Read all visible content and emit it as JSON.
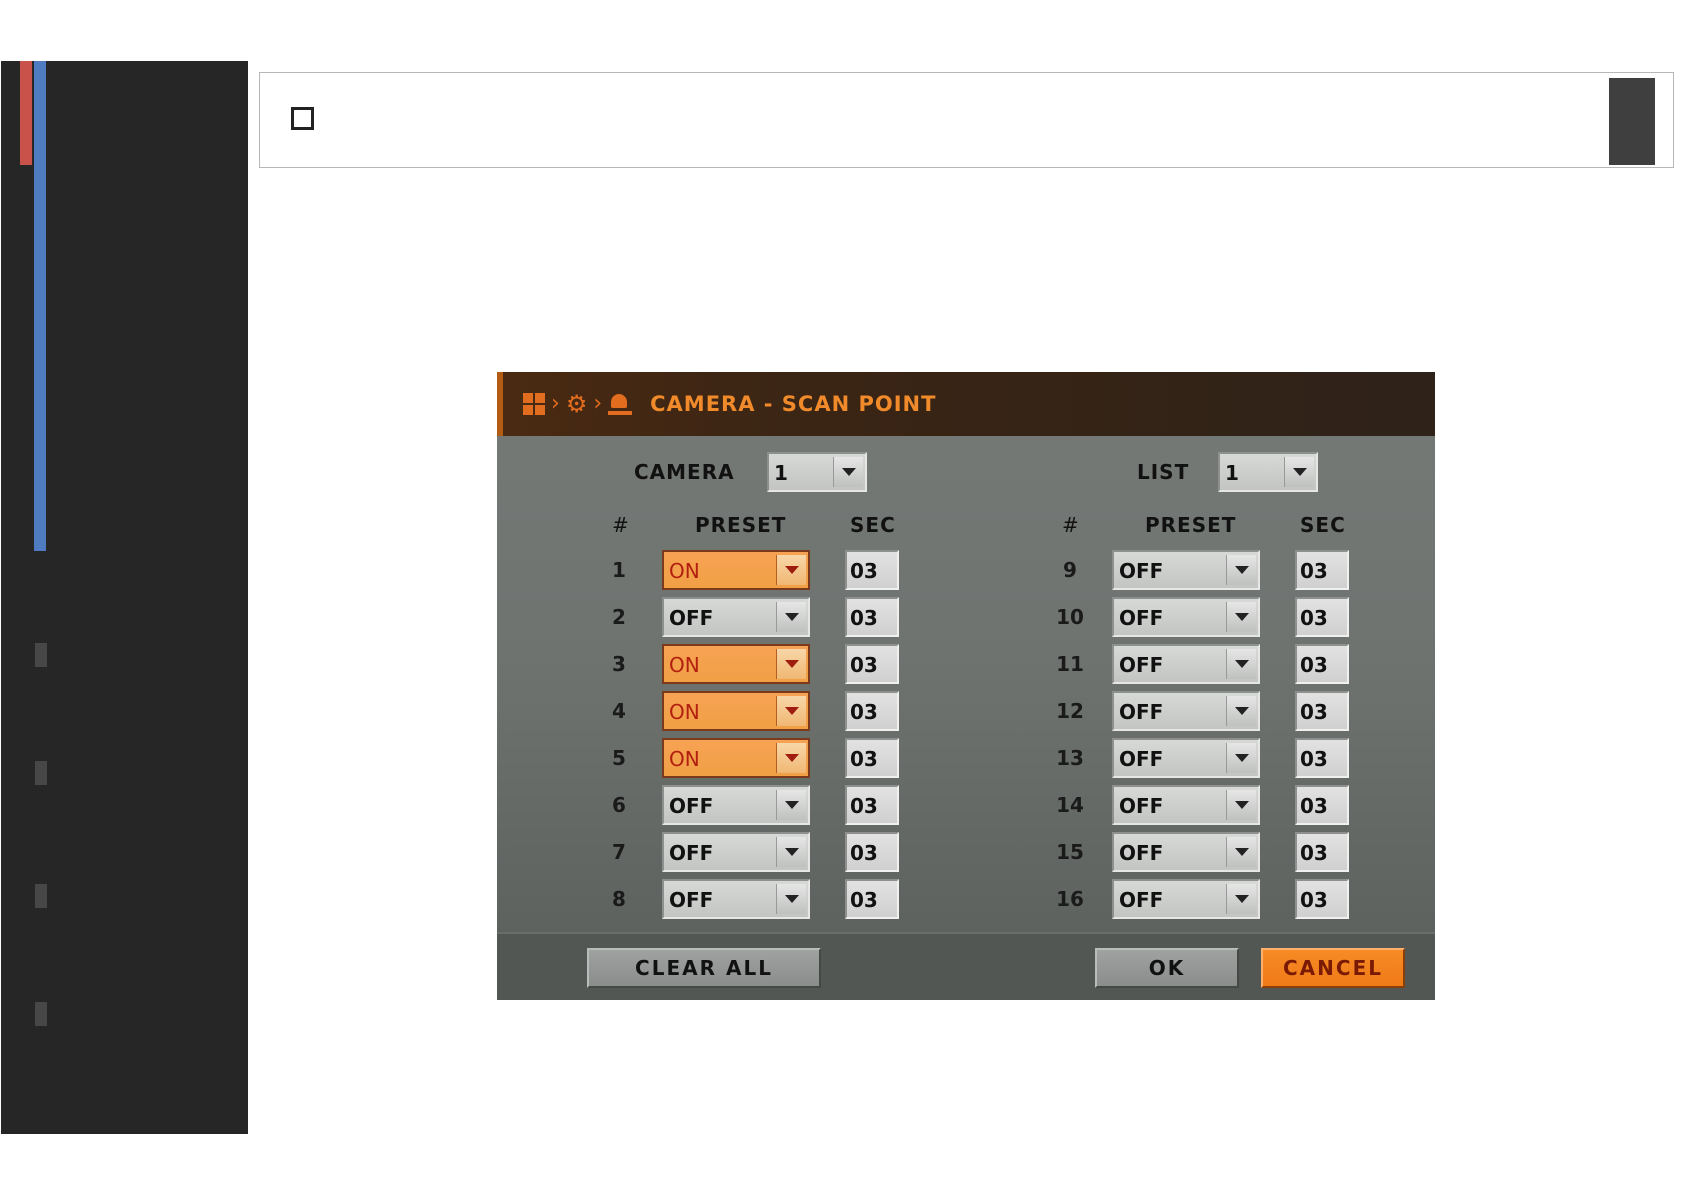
{
  "dialog": {
    "title": "CAMERA - SCAN POINT",
    "breadcrumb_icons": [
      "grid-icon",
      "chevron-right-icon",
      "gear-icon",
      "chevron-right-icon",
      "camera-icon"
    ],
    "camera_label": "CAMERA",
    "camera_value": "1",
    "list_label": "LIST",
    "list_value": "1",
    "headers": {
      "num": "#",
      "preset": "PRESET",
      "sec": "SEC"
    },
    "left_rows": [
      {
        "num": "1",
        "preset": "ON",
        "sec": "03"
      },
      {
        "num": "2",
        "preset": "OFF",
        "sec": "03"
      },
      {
        "num": "3",
        "preset": "ON",
        "sec": "03"
      },
      {
        "num": "4",
        "preset": "ON",
        "sec": "03"
      },
      {
        "num": "5",
        "preset": "ON",
        "sec": "03"
      },
      {
        "num": "6",
        "preset": "OFF",
        "sec": "03"
      },
      {
        "num": "7",
        "preset": "OFF",
        "sec": "03"
      },
      {
        "num": "8",
        "preset": "OFF",
        "sec": "03"
      }
    ],
    "right_rows": [
      {
        "num": "9",
        "preset": "OFF",
        "sec": "03"
      },
      {
        "num": "10",
        "preset": "OFF",
        "sec": "03"
      },
      {
        "num": "11",
        "preset": "OFF",
        "sec": "03"
      },
      {
        "num": "12",
        "preset": "OFF",
        "sec": "03"
      },
      {
        "num": "13",
        "preset": "OFF",
        "sec": "03"
      },
      {
        "num": "14",
        "preset": "OFF",
        "sec": "03"
      },
      {
        "num": "15",
        "preset": "OFF",
        "sec": "03"
      },
      {
        "num": "16",
        "preset": "OFF",
        "sec": "03"
      }
    ],
    "buttons": {
      "clear_all": "CLEAR ALL",
      "ok": "OK",
      "cancel": "CANCEL"
    }
  },
  "colors": {
    "accent": "#e36d1e",
    "on_fill": "#f1a045",
    "title_bar": "#3b2514",
    "dialog_bg": "#6f7370",
    "side_panel": "#262626",
    "side_red": "#c9524b",
    "side_blue": "#4f7bc0"
  }
}
